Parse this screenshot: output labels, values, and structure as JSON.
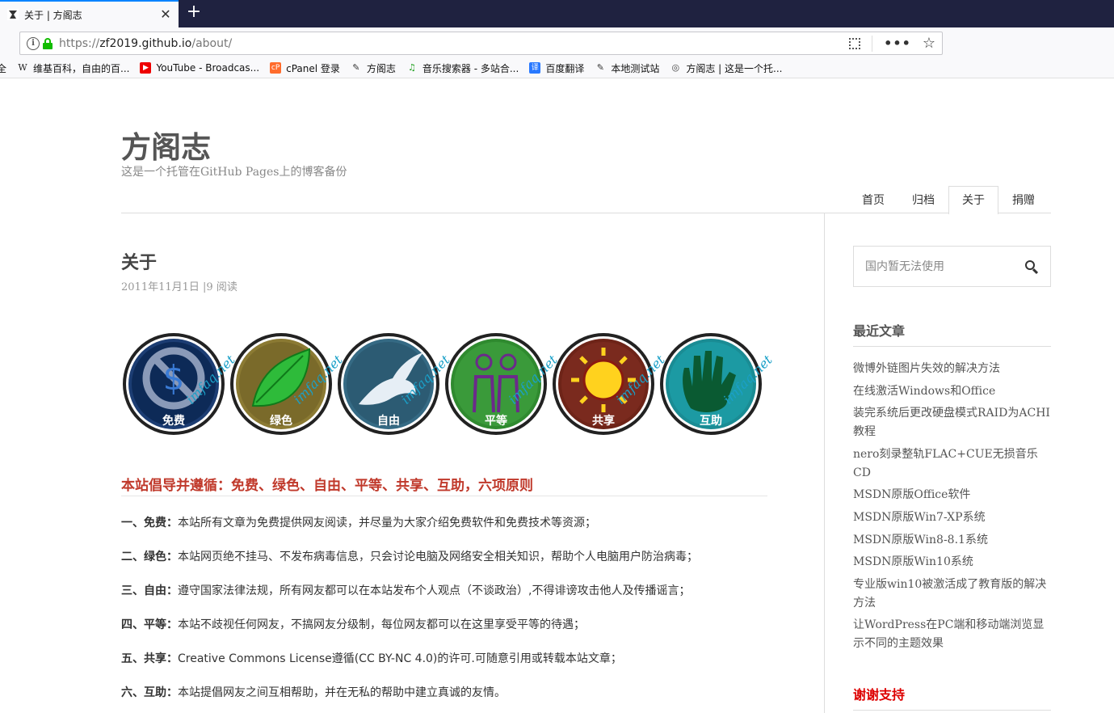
{
  "browser": {
    "tab_title": "关于 | 方阁志",
    "url_prefix": "https://",
    "url_host": "zf2019.github.io",
    "url_path": "/about/",
    "more_icon": "more-dots-icon",
    "bookmarks": [
      {
        "label": "全",
        "icon": "none"
      },
      {
        "label": "维基百科，自由的百...",
        "icon": "wikipedia-icon"
      },
      {
        "label": "YouTube - Broadcas...",
        "icon": "youtube-icon"
      },
      {
        "label": "cPanel 登录",
        "icon": "cpanel-icon"
      },
      {
        "label": "方阁志",
        "icon": "site-icon"
      },
      {
        "label": "音乐搜索器 - 多站合...",
        "icon": "music-icon"
      },
      {
        "label": "百度翻译",
        "icon": "translate-icon"
      },
      {
        "label": "本地测试站",
        "icon": "site-icon"
      },
      {
        "label": "方阁志 | 这是一个托...",
        "icon": "globe-icon"
      }
    ]
  },
  "site": {
    "title": "方阁志",
    "description": "这是一个托管在GitHub Pages上的博客备份"
  },
  "nav": [
    "首页",
    "归档",
    "关于",
    "捐赠"
  ],
  "nav_active": "关于",
  "entry": {
    "title": "关于",
    "meta": "2011年11月1日 |9 阅读"
  },
  "badges": [
    {
      "label": "免费",
      "color": "#0d2a57",
      "ring": "#1c3d73",
      "icon": "no-dollar-icon"
    },
    {
      "label": "绿色",
      "color": "#7a6a2a",
      "ring": "#8b7a33",
      "icon": "leaf-icon"
    },
    {
      "label": "自由",
      "color": "#2c5b73",
      "ring": "#356a84",
      "icon": "dove-icon"
    },
    {
      "label": "平等",
      "color": "#3a9a3a",
      "ring": "#2f8a2f",
      "icon": "people-icon"
    },
    {
      "label": "共享",
      "color": "#7a2a1e",
      "ring": "#6e2418",
      "icon": "sun-icon"
    },
    {
      "label": "互助",
      "color": "#1c9aa3",
      "ring": "#1a8c94",
      "icon": "hand-icon"
    }
  ],
  "watermark": "imfaq.net",
  "principles": {
    "heading": "本站倡导并遵循：免费、绿色、自由、平等、共享、互助，六项原则",
    "items": [
      {
        "label": "一、免费：",
        "text": "本站所有文章为免费提供网友阅读，并尽量为大家介绍免费软件和免费技术等资源；"
      },
      {
        "label": "二、绿色：",
        "text": "本站网页绝不挂马、不发布病毒信息，只会讨论电脑及网络安全相关知识，帮助个人电脑用户防治病毒；"
      },
      {
        "label": "三、自由：",
        "text": "遵守国家法律法规，所有网友都可以在本站发布个人观点（不谈政治）,不得诽谤攻击他人及传播谣言；"
      },
      {
        "label": "四、平等：",
        "text": "本站不歧视任何网友，不搞网友分级制，每位网友都可以在这里享受平等的待遇；"
      },
      {
        "label": "五、共享：",
        "text": "Creative Commons License遵循(CC BY-NC 4.0)的许可.可随意引用或转载本站文章；"
      },
      {
        "label": "六、互助：",
        "text": "本站提倡网友之间互相帮助，并在无私的帮助中建立真诚的友情。"
      }
    ]
  },
  "sidebar": {
    "search_placeholder": "国内暂无法使用",
    "recent_title": "最近文章",
    "recent": [
      "微博外链图片失效的解决方法",
      "在线激活Windows和Office",
      "装完系统后更改硬盘模式RAID为ACHI教程",
      "nero刻录整轨FLAC+CUE无损音乐CD",
      "MSDN原版Office软件",
      "MSDN原版Win7-XP系统",
      "MSDN原版Win8-8.1系统",
      "MSDN原版Win10系统",
      "专业版win10被激活成了教育版的解决方法",
      "让WordPress在PC端和移动端浏览显示不同的主题效果"
    ],
    "thanks_title": "谢谢支持"
  }
}
